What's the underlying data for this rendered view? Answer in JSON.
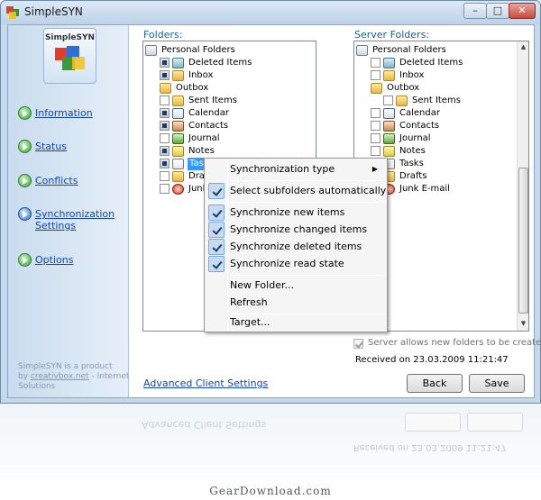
{
  "window": {
    "title": "SimpleSYN",
    "min_glyph": "–",
    "max_glyph": "□",
    "close_glyph": "✕"
  },
  "sidebar": {
    "logo_text": "SimpleSYN",
    "items": [
      {
        "label": "Information",
        "icon": "green-arrow-icon"
      },
      {
        "label": "Status",
        "icon": "green-arrow-icon"
      },
      {
        "label": "Conflicts",
        "icon": "green-arrow-icon"
      },
      {
        "label": "Synchronization Settings",
        "label_line1": "Synchronization",
        "label_line2": "Settings",
        "icon": "blue-arrow-icon",
        "active": true
      },
      {
        "label": "Options",
        "icon": "green-arrow-icon"
      }
    ],
    "product_line1": "SimpleSYN is a product",
    "product_by": "by",
    "product_link": "creativbox.net",
    "product_suffix": "- Internet",
    "product_line3": "Solutions"
  },
  "folders": {
    "label": "Folders:",
    "items": [
      {
        "label": "Personal Folders",
        "check": "partial"
      },
      {
        "label": "Deleted Items",
        "check": "on"
      },
      {
        "label": "Inbox",
        "check": "on"
      },
      {
        "label": "Outbox",
        "check": "none"
      },
      {
        "label": "Sent Items",
        "check": "off"
      },
      {
        "label": "Calendar",
        "check": "on"
      },
      {
        "label": "Contacts",
        "check": "on"
      },
      {
        "label": "Journal",
        "check": "off"
      },
      {
        "label": "Notes",
        "check": "on"
      },
      {
        "label": "Tasks",
        "check": "on"
      },
      {
        "label": "Drafts",
        "check": "off"
      },
      {
        "label": "Junk",
        "check": "off"
      }
    ]
  },
  "server_folders": {
    "label": "Server Folders:",
    "items": [
      {
        "label": "Personal Folders"
      },
      {
        "label": "Deleted Items"
      },
      {
        "label": "Inbox"
      },
      {
        "label": "Outbox"
      },
      {
        "label": "Sent Items"
      },
      {
        "label": "Calendar"
      },
      {
        "label": "Contacts"
      },
      {
        "label": "Journal"
      },
      {
        "label": "Notes"
      },
      {
        "label": "Tasks"
      },
      {
        "label": "Drafts"
      },
      {
        "label": "Junk E-mail"
      }
    ],
    "server_allows_label": "Server allows new folders to be created",
    "server_allows_checked": true,
    "received": "Received on 23.03.2009 11:21:47"
  },
  "context_menu": {
    "items": [
      {
        "label": "Synchronization type",
        "submenu": true,
        "checked": false
      },
      {
        "label": "Select subfolders automatically",
        "checked": true
      },
      {
        "label": "Synchronize new items",
        "checked": true
      },
      {
        "label": "Synchronize changed items",
        "checked": true
      },
      {
        "label": "Synchronize deleted items",
        "checked": true
      },
      {
        "label": "Synchronize read state",
        "checked": true
      },
      {
        "label": "New Folder...",
        "checked": false
      },
      {
        "label": "Refresh",
        "checked": false
      },
      {
        "label": "Target...",
        "checked": false
      }
    ],
    "submenu_arrow": "▶"
  },
  "footer": {
    "advanced_link": "Advanced Client Settings",
    "back_button": "Back",
    "save_button": "Save"
  },
  "reflection": {
    "advanced_link": "Advanced Client Settings",
    "received": "Received on 23.03.2009 11:21:47"
  },
  "watermark": "GearDownload.com"
}
